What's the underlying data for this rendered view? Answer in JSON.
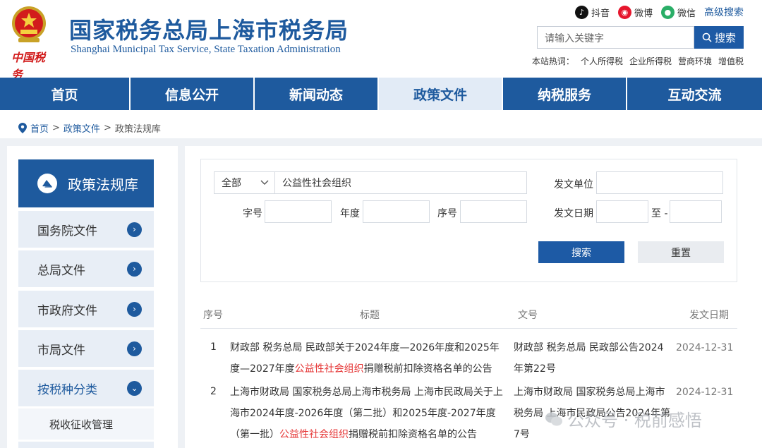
{
  "header": {
    "brand_text": "中国税务",
    "title_cn": "国家税务总局上海市税务局",
    "title_en": "Shanghai Municipal Tax Service, State Taxation Administration",
    "social": [
      {
        "label": "抖音",
        "icon": "douyin-icon",
        "color": "#111111"
      },
      {
        "label": "微博",
        "icon": "weibo-icon",
        "color": "#e6162d"
      },
      {
        "label": "微信",
        "icon": "wechat-icon",
        "color": "#2aae67"
      }
    ],
    "advanced_search": "高级搜索",
    "search_placeholder": "请输入关键字",
    "search_button": "搜索",
    "hot_label": "本站热词：",
    "hot_words": [
      "个人所得税",
      "企业所得税",
      "营商环境",
      "增值税"
    ]
  },
  "nav": [
    {
      "label": "首页",
      "active": false
    },
    {
      "label": "信息公开",
      "active": false
    },
    {
      "label": "新闻动态",
      "active": false
    },
    {
      "label": "政策文件",
      "active": true
    },
    {
      "label": "纳税服务",
      "active": false
    },
    {
      "label": "互动交流",
      "active": false
    }
  ],
  "breadcrumb": {
    "home": "首页",
    "sep": ">",
    "level1": "政策文件",
    "current": "政策法规库"
  },
  "sidebar": {
    "heading": "政策法规库",
    "items": [
      "国务院文件",
      "总局文件",
      "市政府文件",
      "市局文件",
      "按税种分类"
    ],
    "sub_item": "税收征收管理"
  },
  "filter": {
    "scope_value": "全部",
    "keyword_value": "公益性社会组织",
    "issuer_label": "发文单位",
    "doc_no_label": "字号",
    "year_label": "年度",
    "seq_label": "序号",
    "date_label": "发文日期",
    "to_label": "至 -",
    "search_button": "搜索",
    "reset_button": "重置"
  },
  "table": {
    "headers": {
      "num": "序号",
      "title": "标题",
      "doc": "文号",
      "date": "发文日期"
    },
    "rows": [
      {
        "num": "1",
        "title_pre": "财政部 税务总局 民政部关于2024年度—2026年度和2025年度—2027年度",
        "title_hl": "公益性社会组织",
        "title_post": "捐赠税前扣除资格名单的公告",
        "doc": "财政部 税务总局 民政部公告2024年第22号",
        "date": "2024-12-31"
      },
      {
        "num": "2",
        "title_pre": "上海市财政局 国家税务总局上海市税务局 上海市民政局关于上海市2024年度-2026年度（第二批）和2025年度-2027年度（第一批）",
        "title_hl": "公益性社会组织",
        "title_post": "捐赠税前扣除资格名单的公告",
        "doc": "上海市财政局 国家税务总局上海市税务局 上海市民政局公告2024年第7号",
        "date": "2024-12-31"
      }
    ]
  },
  "watermark": "公众号 · 税前感悟",
  "colors": {
    "primary": "#1e5a9e",
    "highlight": "#e53535",
    "brand_red": "#d21c1c"
  }
}
